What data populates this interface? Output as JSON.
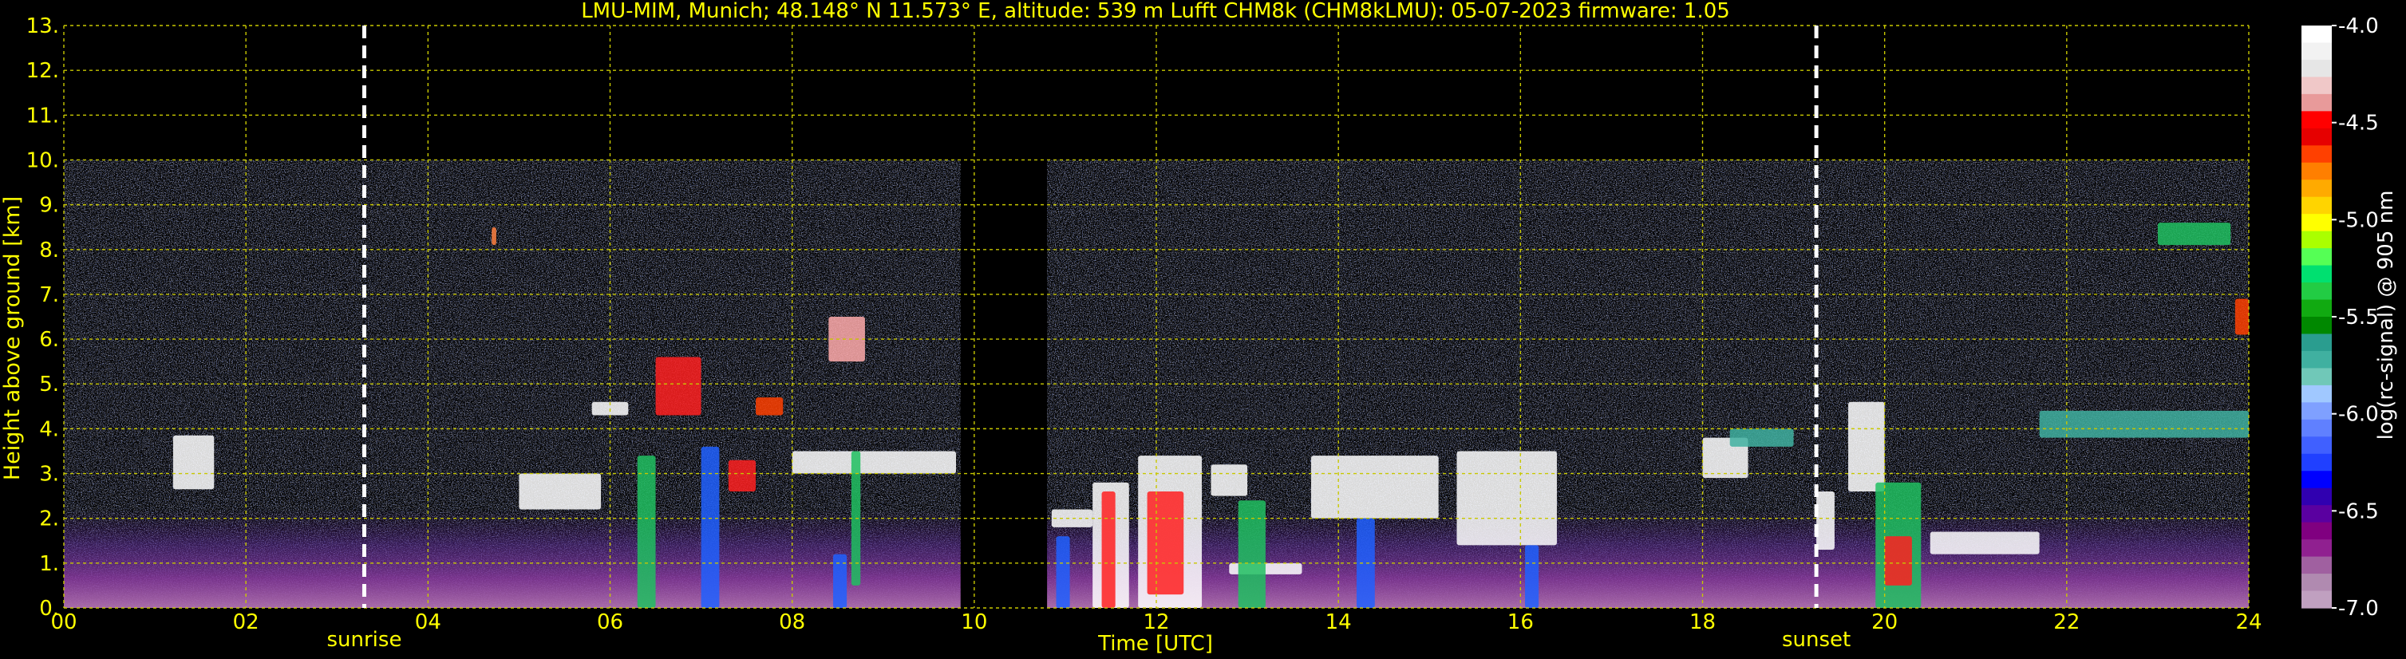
{
  "chart_data": {
    "type": "heatmap",
    "title": "LMU-MIM, Munich; 48.148° N 11.573° E, altitude: 539 m    Lufft CHM8k (CHM8kLMU): 05-07-2023    firmware: 1.05",
    "xlabel": "Time [UTC]",
    "ylabel": "Height above ground [km]",
    "colorbar_label": "log(rc-signal) @ 905 nm",
    "xlim": [
      0,
      24
    ],
    "ylim": [
      0,
      13
    ],
    "x_ticks": [
      "00",
      "02",
      "04",
      "06",
      "08",
      "10",
      "12",
      "14",
      "16",
      "18",
      "20",
      "22",
      "24"
    ],
    "y_ticks": [
      "0.",
      "1.",
      "2.",
      "3.",
      "4.",
      "5.",
      "6.",
      "7.",
      "8.",
      "9.",
      "10.",
      "11.",
      "12.",
      "13."
    ],
    "colorbar_range": [
      -7.0,
      -4.0
    ],
    "colorbar_ticks": [
      "-4.0",
      "-4.5",
      "-5.0",
      "-5.5",
      "-6.0",
      "-6.5",
      "-7.0"
    ],
    "colorbar_colors": [
      "#ffffff",
      "#f2f2f2",
      "#e6e6e6",
      "#f0c8c8",
      "#e89a9a",
      "#ff0000",
      "#e60000",
      "#ff4000",
      "#ff7f00",
      "#ffaa00",
      "#ffd400",
      "#ffff00",
      "#aaff00",
      "#55ff55",
      "#00e070",
      "#22cc44",
      "#11aa11",
      "#008800",
      "#2a9d8f",
      "#40b0a0",
      "#70c8b8",
      "#a0c8ff",
      "#7fa0ff",
      "#6080ff",
      "#4060ff",
      "#2040ff",
      "#0000ff",
      "#3000b0",
      "#5a00a0",
      "#800080",
      "#902090",
      "#a060a0",
      "#b08ab0",
      "#c0a0c0"
    ],
    "data_max_height_km": 10,
    "data_gap": [
      9.85,
      10.8
    ],
    "vlines": [
      {
        "label": "sunrise",
        "x": 3.3
      },
      {
        "label": "sunset",
        "x": 19.25
      }
    ],
    "cloud_layers": [
      {
        "t0": 1.2,
        "t1": 1.65,
        "h0": 2.65,
        "h1": 3.85,
        "color": "#ffffff"
      },
      {
        "t0": 4.7,
        "t1": 4.75,
        "h0": 8.1,
        "h1": 8.5,
        "color": "#ff8040"
      },
      {
        "t0": 5.0,
        "t1": 5.9,
        "h0": 2.2,
        "h1": 3.0,
        "color": "#ffffff"
      },
      {
        "t0": 5.8,
        "t1": 6.2,
        "h0": 4.3,
        "h1": 4.6,
        "color": "#ffffff"
      },
      {
        "t0": 6.3,
        "t1": 6.5,
        "h0": 0.0,
        "h1": 3.4,
        "color": "#20c060"
      },
      {
        "t0": 6.5,
        "t1": 7.0,
        "h0": 4.3,
        "h1": 5.6,
        "color": "#ff2020"
      },
      {
        "t0": 7.3,
        "t1": 7.6,
        "h0": 2.6,
        "h1": 3.3,
        "color": "#ff2020"
      },
      {
        "t0": 7.0,
        "t1": 7.2,
        "h0": 0.0,
        "h1": 3.6,
        "color": "#2060ff"
      },
      {
        "t0": 7.6,
        "t1": 7.9,
        "h0": 4.3,
        "h1": 4.7,
        "color": "#ff4000"
      },
      {
        "t0": 8.0,
        "t1": 9.8,
        "h0": 3.0,
        "h1": 3.5,
        "color": "#ffffff"
      },
      {
        "t0": 8.4,
        "t1": 8.8,
        "h0": 5.5,
        "h1": 6.5,
        "color": "#ffaaaa"
      },
      {
        "t0": 8.65,
        "t1": 8.75,
        "h0": 0.5,
        "h1": 3.5,
        "color": "#20c060"
      },
      {
        "t0": 8.45,
        "t1": 8.6,
        "h0": 0.0,
        "h1": 1.2,
        "color": "#2060ff"
      },
      {
        "t0": 10.85,
        "t1": 11.3,
        "h0": 1.8,
        "h1": 2.2,
        "color": "#ffffff"
      },
      {
        "t0": 10.9,
        "t1": 11.05,
        "h0": 0.0,
        "h1": 1.6,
        "color": "#2060ff"
      },
      {
        "t0": 11.3,
        "t1": 11.7,
        "h0": 0.0,
        "h1": 2.8,
        "color": "#ffffff"
      },
      {
        "t0": 11.4,
        "t1": 11.55,
        "h0": 0.0,
        "h1": 2.6,
        "color": "#ff2020"
      },
      {
        "t0": 11.8,
        "t1": 12.5,
        "h0": 0.0,
        "h1": 3.4,
        "color": "#ffffff"
      },
      {
        "t0": 11.9,
        "t1": 12.3,
        "h0": 0.3,
        "h1": 2.6,
        "color": "#ff2020"
      },
      {
        "t0": 12.6,
        "t1": 13.0,
        "h0": 2.5,
        "h1": 3.2,
        "color": "#ffffff"
      },
      {
        "t0": 12.8,
        "t1": 13.6,
        "h0": 0.75,
        "h1": 1.0,
        "color": "#ffffff"
      },
      {
        "t0": 12.9,
        "t1": 13.2,
        "h0": 0.0,
        "h1": 2.4,
        "color": "#20c060"
      },
      {
        "t0": 13.7,
        "t1": 15.1,
        "h0": 2.0,
        "h1": 3.4,
        "color": "#ffffff"
      },
      {
        "t0": 14.2,
        "t1": 14.4,
        "h0": 0.0,
        "h1": 2.0,
        "color": "#2060ff"
      },
      {
        "t0": 15.3,
        "t1": 16.4,
        "h0": 1.4,
        "h1": 3.5,
        "color": "#ffffff"
      },
      {
        "t0": 16.05,
        "t1": 16.2,
        "h0": 0.0,
        "h1": 1.4,
        "color": "#2060ff"
      },
      {
        "t0": 18.0,
        "t1": 18.5,
        "h0": 2.9,
        "h1": 3.8,
        "color": "#ffffff"
      },
      {
        "t0": 18.3,
        "t1": 19.0,
        "h0": 3.6,
        "h1": 4.0,
        "color": "#40b0a0"
      },
      {
        "t0": 19.25,
        "t1": 19.45,
        "h0": 1.3,
        "h1": 2.6,
        "color": "#ffffff"
      },
      {
        "t0": 19.6,
        "t1": 20.0,
        "h0": 2.6,
        "h1": 4.6,
        "color": "#ffffff"
      },
      {
        "t0": 19.9,
        "t1": 20.4,
        "h0": 0.0,
        "h1": 2.8,
        "color": "#20c060"
      },
      {
        "t0": 20.0,
        "t1": 20.3,
        "h0": 0.5,
        "h1": 1.6,
        "color": "#ff2020"
      },
      {
        "t0": 20.5,
        "t1": 21.7,
        "h0": 1.2,
        "h1": 1.7,
        "color": "#ffffff"
      },
      {
        "t0": 21.7,
        "t1": 24.0,
        "h0": 3.8,
        "h1": 4.4,
        "color": "#40b0a0"
      },
      {
        "t0": 23.0,
        "t1": 23.8,
        "h0": 8.1,
        "h1": 8.6,
        "color": "#20c060"
      },
      {
        "t0": 23.85,
        "t1": 24.0,
        "h0": 6.1,
        "h1": 6.9,
        "color": "#ff4000"
      }
    ]
  }
}
